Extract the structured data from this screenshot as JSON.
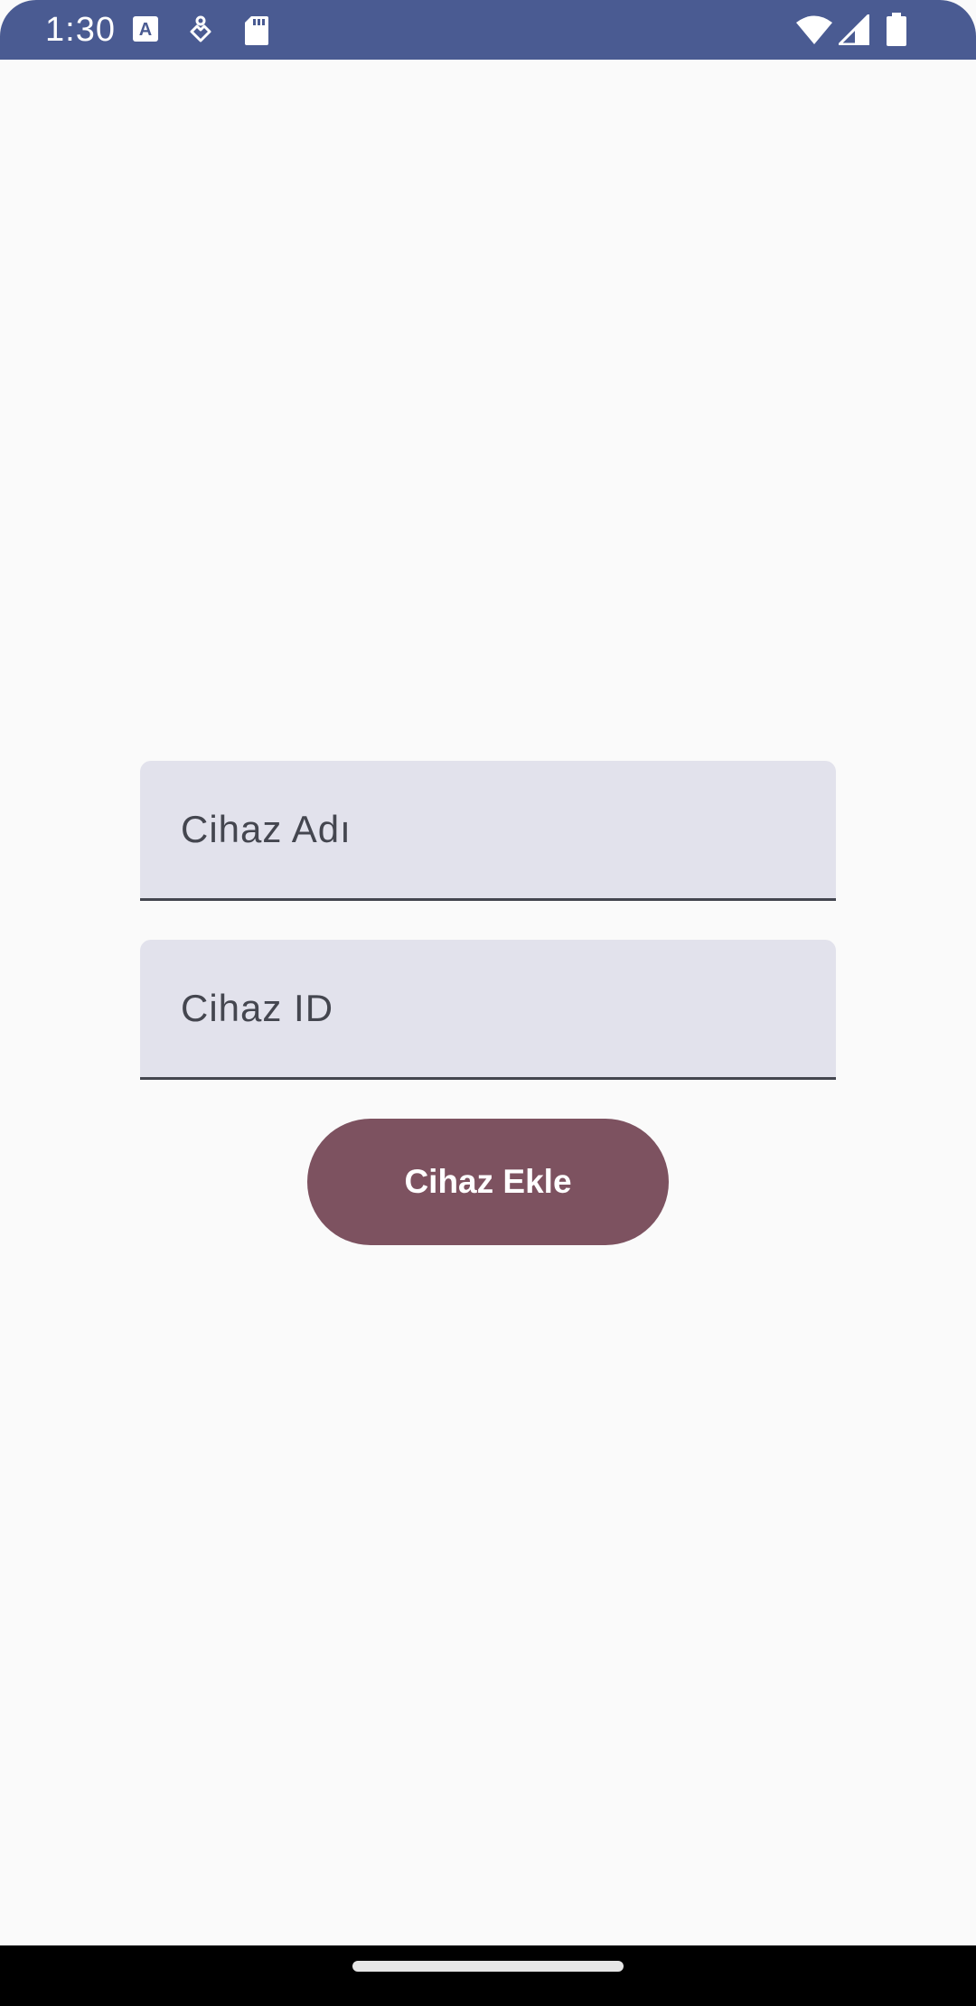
{
  "status_bar": {
    "time": "1:30",
    "left_icons": [
      "font-a-icon",
      "accessibility-icon",
      "sd-card-icon"
    ],
    "right_icons": [
      "wifi-icon",
      "signal-icon",
      "battery-icon"
    ],
    "background_color": "#4a5b92"
  },
  "form": {
    "device_name_placeholder": "Cihaz Adı",
    "device_id_placeholder": "Cihaz ID",
    "add_button_label": "Cihaz Ekle",
    "field_background_color": "#e2e2ec",
    "button_color": "#7d5260"
  }
}
